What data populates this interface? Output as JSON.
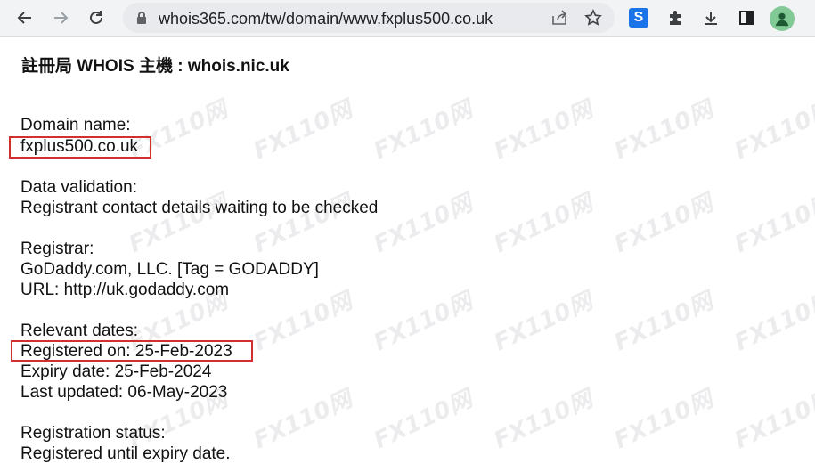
{
  "browser": {
    "url": "whois365.com/tw/domain/www.fxplus500.co.uk"
  },
  "page": {
    "heading": "註冊局 WHOIS 主機 : whois.nic.uk",
    "domain_label": "Domain name:",
    "domain_value": "fxplus500.co.uk",
    "validation_label": "Data validation:",
    "validation_value": "Registrant contact details waiting to be checked",
    "registrar_label": "Registrar:",
    "registrar_name": "GoDaddy.com, LLC. [Tag = GODADDY]",
    "registrar_url": "URL: http://uk.godaddy.com",
    "dates_label": "Relevant dates:",
    "registered_on": "Registered on: 25-Feb-2023",
    "expiry_date": "Expiry date: 25-Feb-2024",
    "last_updated": "Last updated: 06-May-2023",
    "status_label": "Registration status:",
    "status_value": "Registered until expiry date."
  },
  "colors": {
    "highlight": "#d32f2f",
    "toolbar": "#f1f3f4",
    "omnibox": "#e8eaed"
  },
  "icons": [
    "back-arrow-icon",
    "forward-arrow-icon",
    "reload-icon",
    "lock-icon",
    "share-icon",
    "star-icon",
    "extension-s-icon",
    "puzzle-icon",
    "download-icon",
    "sidepanel-icon",
    "profile-icon"
  ]
}
